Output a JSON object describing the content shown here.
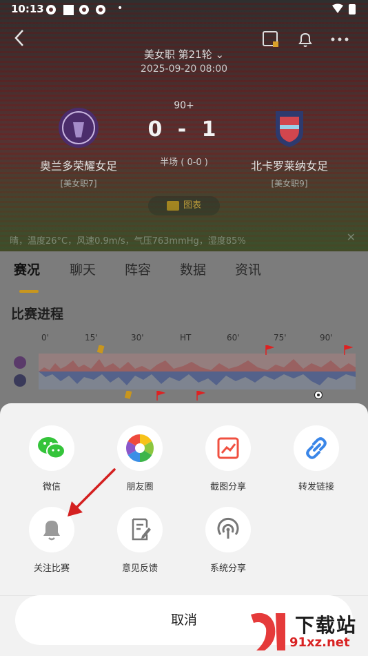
{
  "status_bar": {
    "time": "10:13",
    "dot": "•"
  },
  "match": {
    "league": "美女职 第21轮",
    "chevron": "⌄",
    "datetime": "2025-09-20 08:00",
    "minute": "90+",
    "score": "0 - 1",
    "halftime": "半场 ( 0-0 )",
    "home": {
      "name": "奥兰多荣耀女足",
      "tag": "[美女职7]"
    },
    "away": {
      "name": "北卡罗莱纳女足",
      "tag": "[美女职9]"
    },
    "chart_button": "图表"
  },
  "weather": "晴，温度26°C，风速0.9m/s，气压763mmHg，湿度85%",
  "weather_close": "✕",
  "tabs": [
    {
      "label": "赛况"
    },
    {
      "label": "聊天"
    },
    {
      "label": "阵容"
    },
    {
      "label": "数据"
    },
    {
      "label": "资讯"
    }
  ],
  "progress": {
    "title": "比赛进程",
    "ticks": [
      "0'",
      "15'",
      "30'",
      "HT",
      "60'",
      "75'",
      "90'"
    ]
  },
  "share": {
    "items": [
      {
        "label": "微信",
        "icon": "wechat-icon"
      },
      {
        "label": "朋友圈",
        "icon": "moments-icon"
      },
      {
        "label": "截图分享",
        "icon": "screenshot-share-icon"
      },
      {
        "label": "转发链接",
        "icon": "link-icon"
      },
      {
        "label": "关注比赛",
        "icon": "bell-icon"
      },
      {
        "label": "意见反馈",
        "icon": "feedback-icon"
      },
      {
        "label": "系统分享",
        "icon": "system-share-icon"
      }
    ],
    "cancel": "取消"
  },
  "watermark": {
    "title": "下载站",
    "url": "91xz.net"
  },
  "colors": {
    "accent": "#c8961e",
    "wechat": "#34c43a",
    "screenshot": "#f05040",
    "link": "#3a86e8",
    "gray_icon": "#9a9a9a",
    "arrow": "#d42020"
  }
}
